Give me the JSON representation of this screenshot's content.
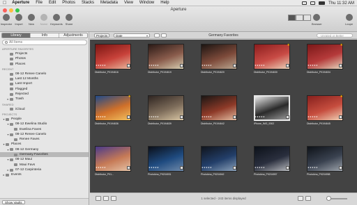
{
  "menubar": {
    "app": "Aperture",
    "items": [
      "File",
      "Edit",
      "Photos",
      "Stacks",
      "Metadata",
      "View",
      "Window",
      "Help"
    ],
    "clock": "Thu 11:32 AM"
  },
  "window": {
    "title": "Aperture"
  },
  "toolbar": {
    "tools": [
      {
        "label": "Inspector",
        "icon": "inspector-icon",
        "enabled": true
      },
      {
        "label": "Import",
        "icon": "import-icon",
        "enabled": true
      },
      {
        "label": "New",
        "icon": "new-icon",
        "enabled": true
      },
      {
        "label": "Name",
        "icon": "name-icon",
        "enabled": false
      },
      {
        "label": "Keywords",
        "icon": "keywords-icon",
        "enabled": true
      },
      {
        "label": "Share",
        "icon": "share-icon",
        "enabled": true
      }
    ],
    "browser_label": "Browser",
    "loupe_label": "Loupe"
  },
  "sidebar": {
    "tabs": [
      {
        "label": "Library",
        "active": true
      },
      {
        "label": "Info",
        "active": false
      },
      {
        "label": "Adjustments",
        "active": false
      }
    ],
    "search_placeholder": "All Items",
    "sections": [
      {
        "heading": "APERTURE FAVORITES",
        "items": [
          {
            "label": "Projects",
            "indent": 1,
            "arrow": ""
          },
          {
            "label": "Photos",
            "indent": 1,
            "arrow": ""
          },
          {
            "label": "Places",
            "indent": 1,
            "arrow": ""
          }
        ]
      },
      {
        "heading": "RECENT",
        "items": [
          {
            "label": "08-12 Renee Canelo",
            "indent": 1,
            "arrow": ""
          },
          {
            "label": "Last 12 Months",
            "indent": 1,
            "arrow": ""
          },
          {
            "label": "Last Import",
            "indent": 1,
            "arrow": ""
          },
          {
            "label": "Flagged",
            "indent": 1,
            "arrow": ""
          },
          {
            "label": "Rejected",
            "indent": 1,
            "arrow": ""
          },
          {
            "label": "Trash",
            "indent": 1,
            "arrow": "▸"
          }
        ]
      },
      {
        "heading": "SHARED",
        "items": [
          {
            "label": "iCloud",
            "indent": 1,
            "arrow": ""
          }
        ]
      },
      {
        "heading": "PROJECTS",
        "items": [
          {
            "label": "People",
            "indent": 0,
            "arrow": "▾"
          },
          {
            "label": "08-12 Ewelina Studio",
            "indent": 1,
            "arrow": "▾"
          },
          {
            "label": "Ewelina Faves",
            "indent": 2,
            "arrow": ""
          },
          {
            "label": "08-12 Renee Canelo",
            "indent": 1,
            "arrow": "▾"
          },
          {
            "label": "Renee Faves",
            "indent": 2,
            "arrow": ""
          },
          {
            "label": "Places",
            "indent": 0,
            "arrow": "▾"
          },
          {
            "label": "08-12 Germany",
            "indent": 1,
            "arrow": "▾"
          },
          {
            "label": "Germany Favorites",
            "indent": 2,
            "arrow": "",
            "selected": true
          },
          {
            "label": "08-12 Maui",
            "indent": 1,
            "arrow": "▾"
          },
          {
            "label": "Maui Favs",
            "indent": 2,
            "arrow": ""
          },
          {
            "label": "07-12 Carpinteria",
            "indent": 1,
            "arrow": "▸"
          },
          {
            "label": "Events",
            "indent": 0,
            "arrow": "▸"
          }
        ]
      }
    ],
    "show_vaults": "Show Vaults"
  },
  "browser": {
    "projects_button": "Projects",
    "sort_value": "Date",
    "title": "Germany Favorites",
    "search_placeholder": "Unrated or Better",
    "status": "1 selected - 243 items displayed"
  },
  "photos": [
    {
      "caption": "Distributor_P9194616",
      "colors": [
        "#7a1512",
        "#c8423a",
        "#e7b79d"
      ],
      "starred": false,
      "selected": false
    },
    {
      "caption": "Distributor_P9194619",
      "colors": [
        "#2a1a16",
        "#8a5c4c",
        "#d6cdb0"
      ],
      "starred": false,
      "selected": false
    },
    {
      "caption": "Distributor_P9194620",
      "colors": [
        "#1c1512",
        "#7d4a3a",
        "#b9a58f"
      ],
      "starred": false,
      "selected": false
    },
    {
      "caption": "Distributor_P9194630",
      "colors": [
        "#8c1d1d",
        "#c84b45",
        "#ebd2b8"
      ],
      "starred": true,
      "selected": false
    },
    {
      "caption": "Distributor_P9194634",
      "colors": [
        "#7b1818",
        "#b53a3a",
        "#e6d5bd"
      ],
      "starred": true,
      "selected": false
    },
    {
      "caption": "Distributor_P9194636",
      "colors": [
        "#1f4a8a",
        "#d0702a",
        "#f1c160"
      ],
      "starred": true,
      "selected": false
    },
    {
      "caption": "Distributor_P9194639",
      "colors": [
        "#2f2521",
        "#7e6d5b",
        "#d9c6a4"
      ],
      "starred": false,
      "selected": false
    },
    {
      "caption": "Distributor_P9194642",
      "colors": [
        "#1a1614",
        "#8e3a28",
        "#e2bba0"
      ],
      "starred": false,
      "selected": false
    },
    {
      "caption": "iPhone_IMG_9302",
      "colors": [
        "#e9e9e9",
        "#2a2a2a",
        "#9a9a9a"
      ],
      "starred": false,
      "selected": true
    },
    {
      "caption": "Distributor_P9194645",
      "colors": [
        "#86201d",
        "#c64d3e",
        "#f0d2b7"
      ],
      "starred": true,
      "selected": false
    },
    {
      "caption": "Distributor_P91...",
      "colors": [
        "#4a3a8a",
        "#c67a56",
        "#e4c2a6"
      ],
      "starred": false,
      "selected": false
    },
    {
      "caption": "Photokina_P9204931",
      "colors": [
        "#0b0f18",
        "#1f4b80",
        "#6e89a9"
      ],
      "starred": false,
      "selected": false
    },
    {
      "caption": "Photokina_P9204942",
      "colors": [
        "#10141c",
        "#233f6a",
        "#8aa0b8"
      ],
      "starred": false,
      "selected": false
    },
    {
      "caption": "Photokina_P9204957",
      "colors": [
        "#0c1119",
        "#2a2f3e",
        "#b7b9bd"
      ],
      "starred": false,
      "selected": false
    },
    {
      "caption": "Photokina_P9204958",
      "colors": [
        "#0e1218",
        "#3a4250",
        "#9da3ab"
      ],
      "starred": false,
      "selected": false
    }
  ]
}
